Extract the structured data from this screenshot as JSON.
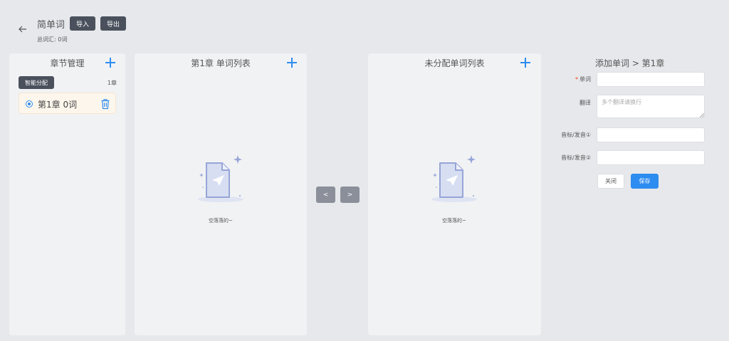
{
  "header": {
    "back_icon": "arrow-left-icon",
    "title": "简单词",
    "import_label": "导入",
    "export_label": "导出",
    "total_words": "总词汇: 0词"
  },
  "chapter_panel": {
    "title": "章节管理",
    "smart_assign_label": "智能分配",
    "chapter_count": "1章",
    "chapters": [
      {
        "label": "第1章 0词",
        "selected": true
      }
    ]
  },
  "word_list_panel": {
    "title": "第1章 单词列表",
    "empty_text": "空落落的~"
  },
  "transfer": {
    "left_label": "<",
    "right_label": ">"
  },
  "unassigned_panel": {
    "title": "未分配单词列表",
    "empty_text": "空落落的~"
  },
  "form": {
    "title": "添加单词 > 第1章",
    "word_label": "单词",
    "word_value": "",
    "translation_label": "翻译",
    "translation_placeholder": "多个翻译请换行",
    "phonetic1_label": "音标/发音①",
    "phonetic1_value": "",
    "phonetic2_label": "音标/发音②",
    "phonetic2_value": "",
    "close_label": "关闭",
    "save_label": "保存"
  },
  "colors": {
    "accent": "#2d8cf0",
    "dark_button": "#4a505c",
    "background": "#e7e8ec",
    "panel": "#f1f2f4",
    "selected_item": "#fdf6ec",
    "required": "#ed4014"
  }
}
